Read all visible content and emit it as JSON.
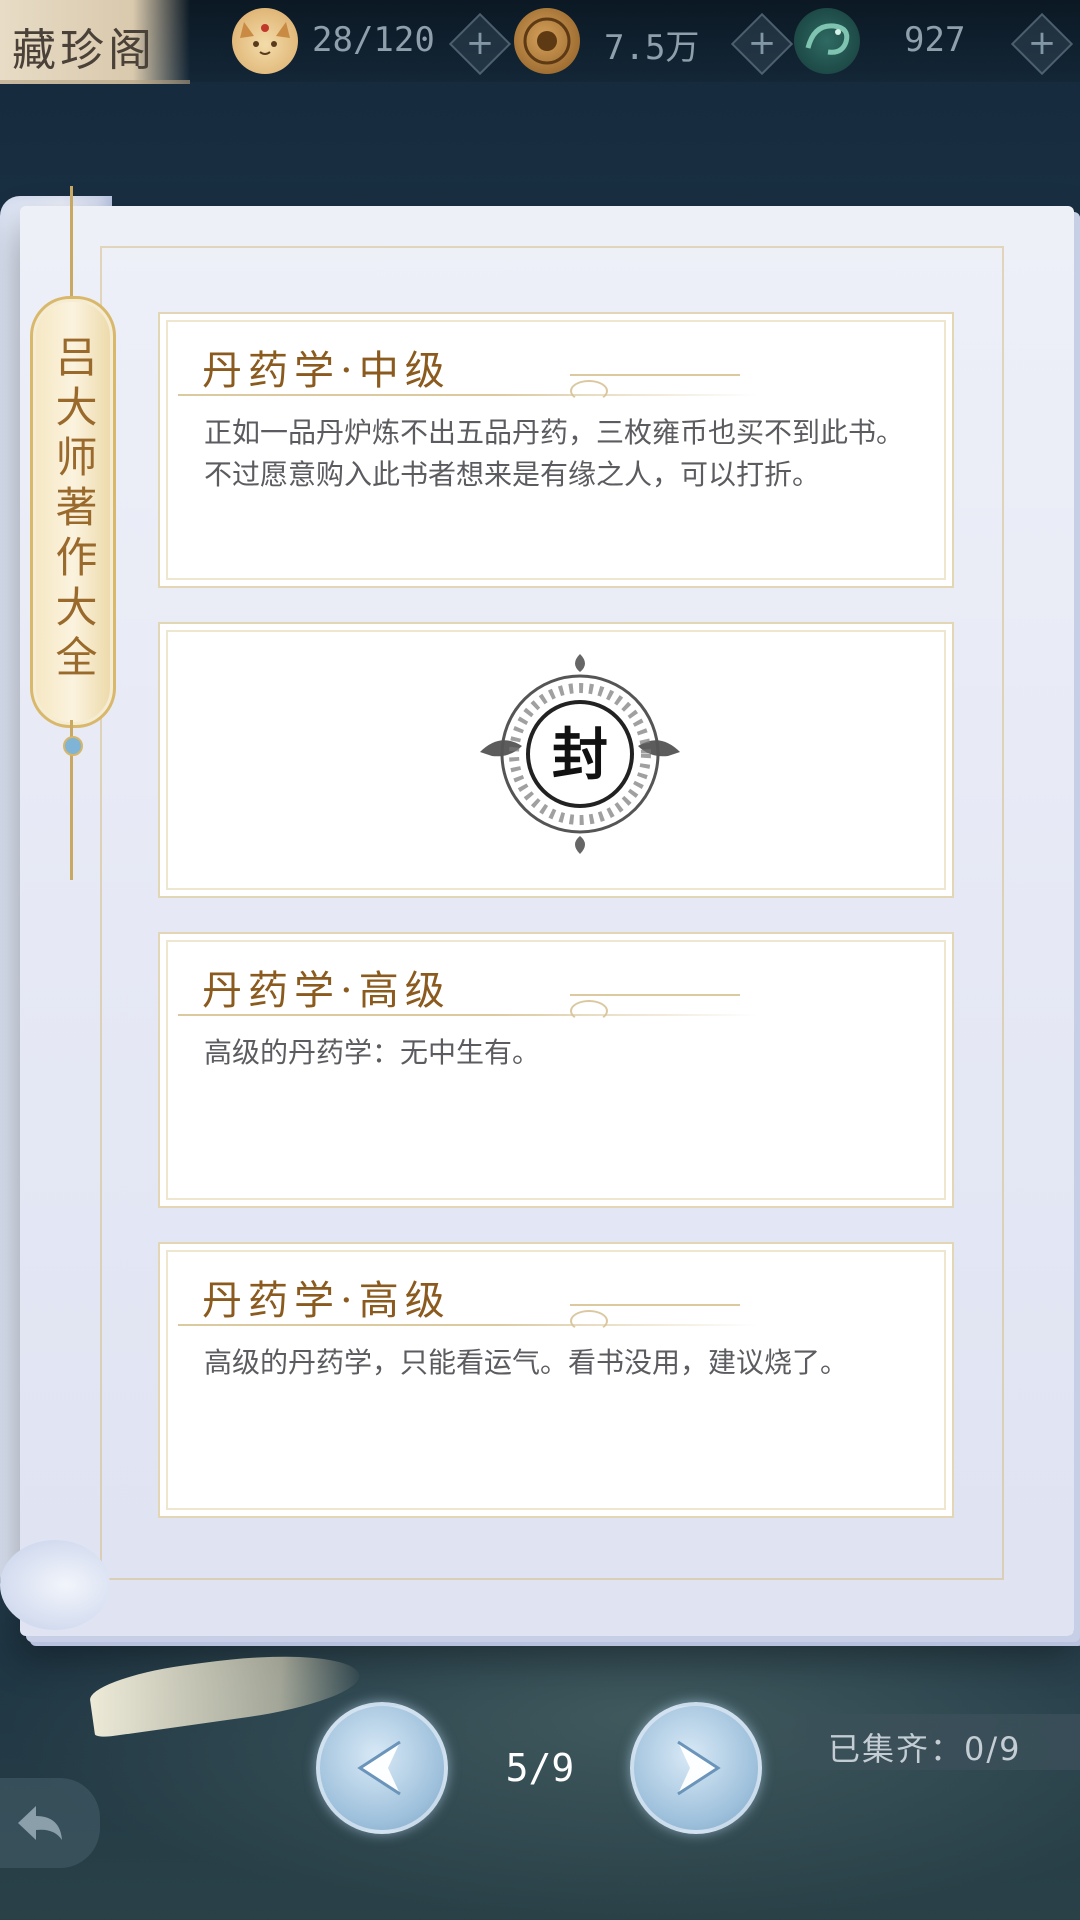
{
  "header": {
    "title": "藏珍阁",
    "resources": [
      {
        "icon": "cat-face-icon",
        "value": "28/120",
        "plus": "+"
      },
      {
        "icon": "coin-icon",
        "value": "7.5万",
        "plus": "+"
      },
      {
        "icon": "jade-dragon-icon",
        "value": "927",
        "plus": "+"
      }
    ]
  },
  "book": {
    "ribbon_title": "吕大师著作大全",
    "cards": [
      {
        "title": "丹药学·中级",
        "description": "正如一品丹炉炼不出五品丹药，三枚雍币也买不到此书。不过愿意购入此书者想来是有缘之人，可以打折。"
      },
      {
        "sealed": true,
        "seal_text": "封"
      },
      {
        "title": "丹药学·高级",
        "description": "高级的丹药学：无中生有。"
      },
      {
        "title": "丹药学·高级",
        "description": "高级的丹药学，只能看运气。看书没用，建议烧了。"
      }
    ]
  },
  "footer": {
    "page_indicator": "5/9",
    "collected": "已集齐：0/9",
    "prev_icon": "arrow-left-icon",
    "next_icon": "arrow-right-icon",
    "back_icon": "back-arrow-icon"
  }
}
